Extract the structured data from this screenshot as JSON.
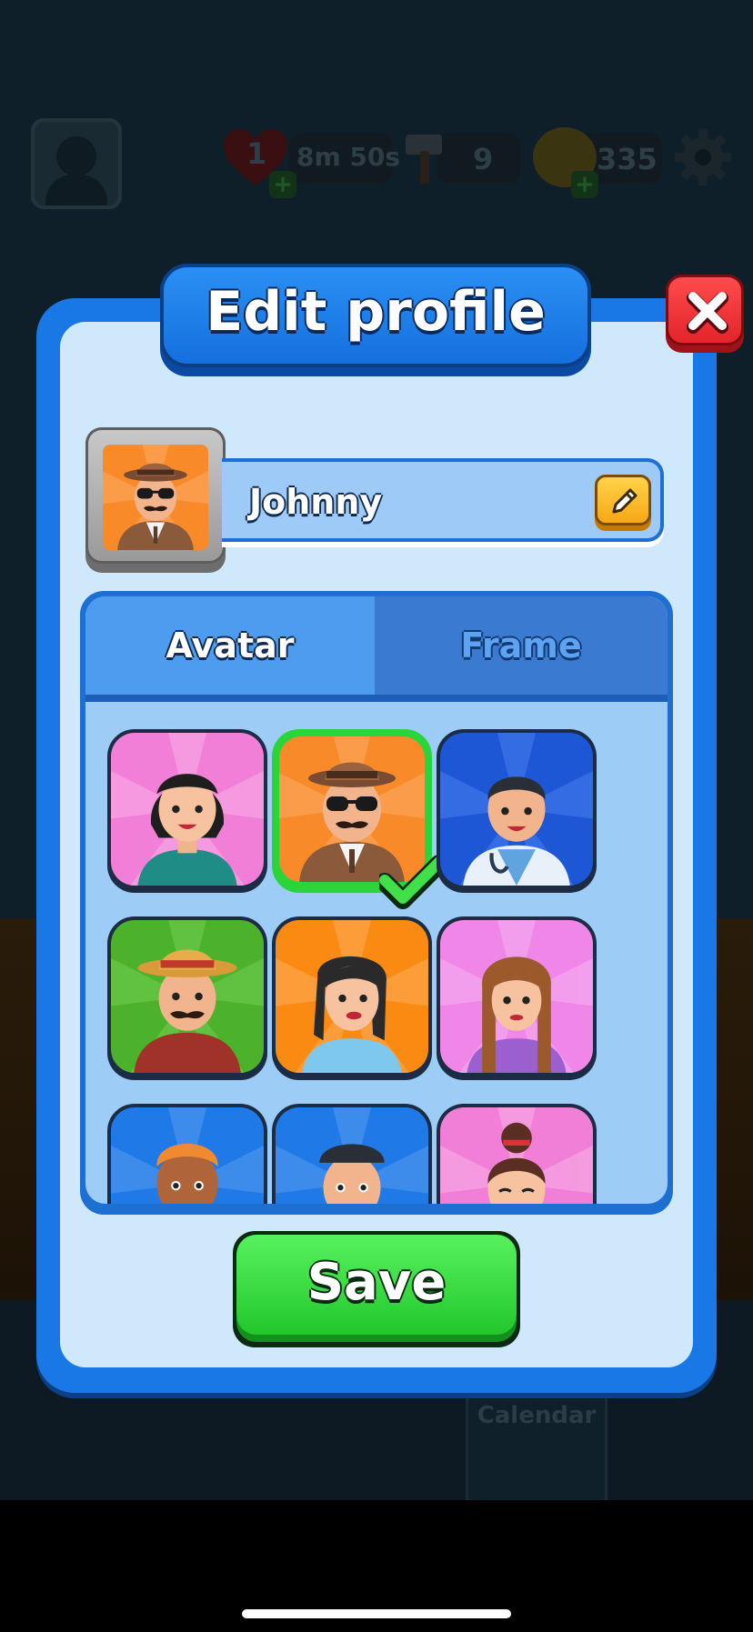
{
  "hud": {
    "lives": "1",
    "life_timer": "8m 50s",
    "hammers": "9",
    "coins": "335"
  },
  "dialog": {
    "title": "Edit profile",
    "player_name": "Johnny",
    "tabs": [
      {
        "label": "Avatar",
        "active": true
      },
      {
        "label": "Frame",
        "active": false
      }
    ],
    "save_label": "Save",
    "avatars": [
      {
        "name": "woman-black-hair",
        "bg": "#f27fd7",
        "selected": false
      },
      {
        "name": "detective-man",
        "bg": "#f98a2a",
        "selected": true
      },
      {
        "name": "doctor-man",
        "bg": "#1d57d6",
        "selected": false
      },
      {
        "name": "farmer-man",
        "bg": "#4cb22b",
        "selected": false
      },
      {
        "name": "woman-dark-hair",
        "bg": "#fb8a13",
        "selected": false
      },
      {
        "name": "woman-long-hair",
        "bg": "#ef86e8",
        "selected": false
      },
      {
        "name": "man-ginger",
        "bg": "#1f7ae8",
        "selected": false
      },
      {
        "name": "man-cap",
        "bg": "#1f7ae8",
        "selected": false
      },
      {
        "name": "woman-bun",
        "bg": "#f27fd7",
        "selected": false
      }
    ]
  },
  "background": {
    "tab_label": "Calendar"
  },
  "colors": {
    "dialog_blue": "#1a78e6",
    "dialog_fill": "#cfe8fb",
    "save_green": "#22c72c",
    "close_red": "#e3242b",
    "selected_border": "#29d63a"
  }
}
